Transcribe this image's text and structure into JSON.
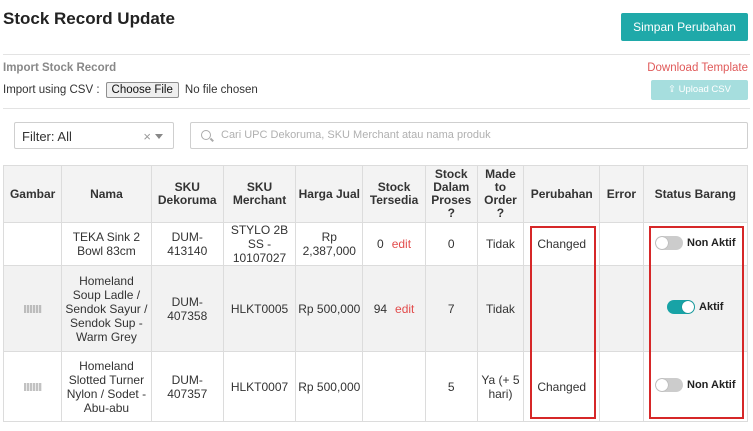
{
  "page": {
    "title": "Stock Record Update"
  },
  "header": {
    "save_label": "Simpan Perubahan"
  },
  "import": {
    "title": "Import Stock Record",
    "csv_label": "Import using CSV :",
    "choose_file_label": "Choose File",
    "no_file_text": "No file chosen",
    "download_template_label": "Download Template",
    "upload_csv_label": "Upload CSV"
  },
  "filter": {
    "value": "Filter: All",
    "clear_glyph": "×"
  },
  "search": {
    "placeholder": "Cari UPC Dekoruma, SKU Merchant atau nama produk"
  },
  "table": {
    "headers": [
      "Gambar",
      "Nama",
      "SKU Dekoruma",
      "SKU Merchant",
      "Harga Jual",
      "Stock Tersedia",
      "Stock Dalam Proses ?",
      "Made to Order ?",
      "Perubahan",
      "Error",
      "Status Barang"
    ],
    "edit_label": "edit",
    "rows": [
      {
        "nama": "TEKA Sink 2 Bowl 83cm",
        "sku_dekoruma": "DUM-413140",
        "sku_merchant": "STYLO 2B SS - 10107027",
        "harga": "Rp 2,387,000",
        "stock": "0",
        "proses": "0",
        "mto": "Tidak",
        "perubahan": "Changed",
        "error": "",
        "status": "Non Aktif",
        "active": false,
        "has_image": false
      },
      {
        "nama": "Homeland Soup Ladle / Sendok Sayur / Sendok Sup - Warm Grey",
        "sku_dekoruma": "DUM-407358",
        "sku_merchant": "HLKT0005",
        "harga": "Rp 500,000",
        "stock": "94",
        "proses": "7",
        "mto": "Tidak",
        "perubahan": "",
        "error": "",
        "status": "Aktif",
        "active": true,
        "has_image": true
      },
      {
        "nama": "Homeland Slotted Turner Nylon / Sodet - Abu-abu",
        "sku_dekoruma": "DUM-407357",
        "sku_merchant": "HLKT0007",
        "harga": "Rp 500,000",
        "stock": "",
        "proses": "5",
        "mto": "Ya (+ 5 hari)",
        "perubahan": "Changed",
        "error": "",
        "status": "Non Aktif",
        "active": false,
        "has_image": true
      }
    ]
  },
  "colors": {
    "accent": "#1fa9a9",
    "link": "#e05a5a",
    "highlight": "#d62728"
  }
}
